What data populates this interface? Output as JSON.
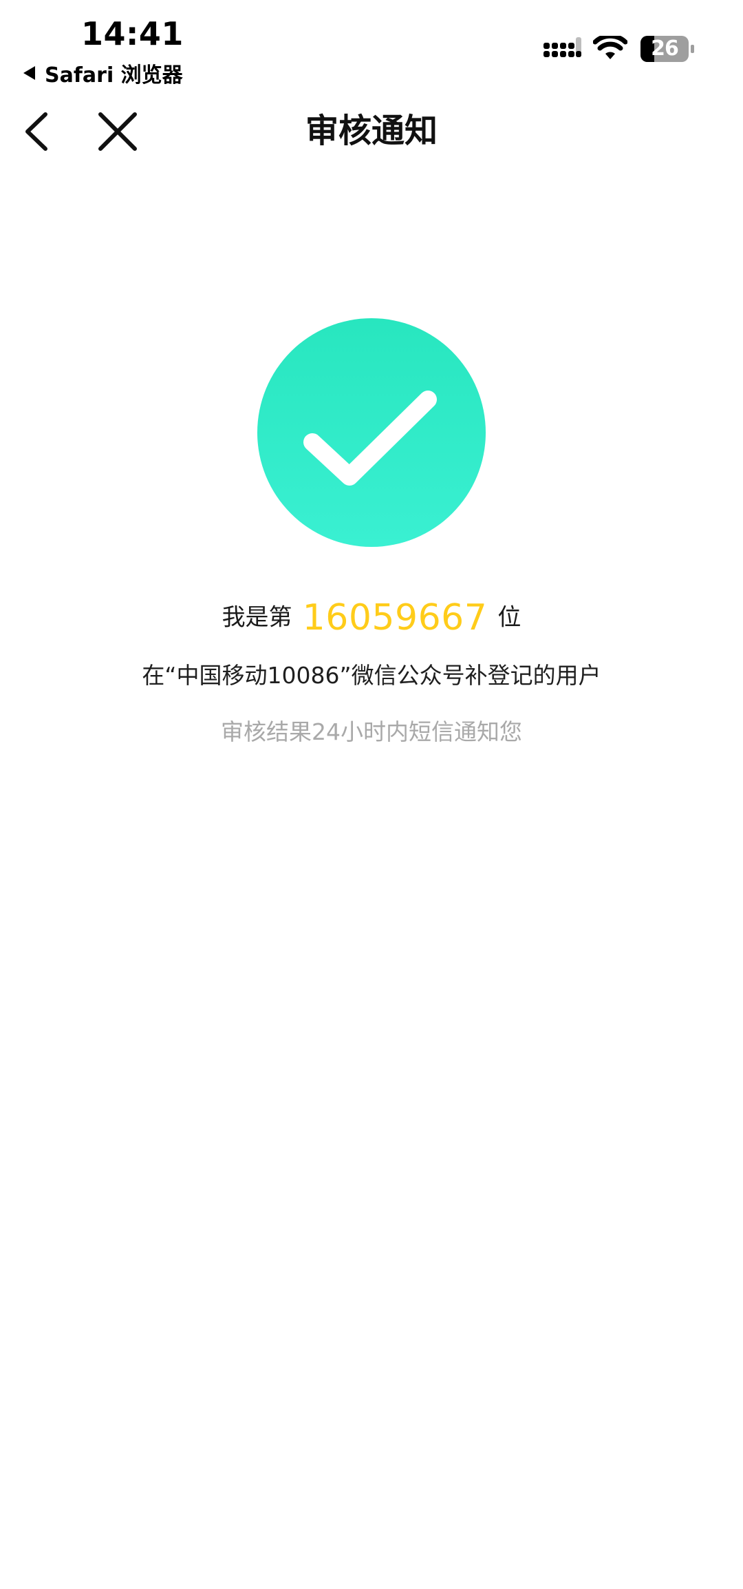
{
  "status_bar": {
    "time": "14:41",
    "back_app_label": "Safari 浏览器",
    "battery_level": "26",
    "signal_icon": "cellular-signal-icon",
    "wifi_icon": "wifi-icon",
    "battery_icon": "battery-icon"
  },
  "nav": {
    "title": "审核通知",
    "back_icon": "chevron-left-icon",
    "close_icon": "close-icon"
  },
  "result": {
    "status_icon": "checkmark-icon",
    "circle_color": "#2ceac6",
    "rank_prefix": "我是第",
    "rank_number": "16059667",
    "rank_suffix": "位",
    "rank_color": "#ffcc1a",
    "description": "在“中国移动10086”微信公众号补登记的用户",
    "notice": "审核结果24小时内短信通知您"
  }
}
